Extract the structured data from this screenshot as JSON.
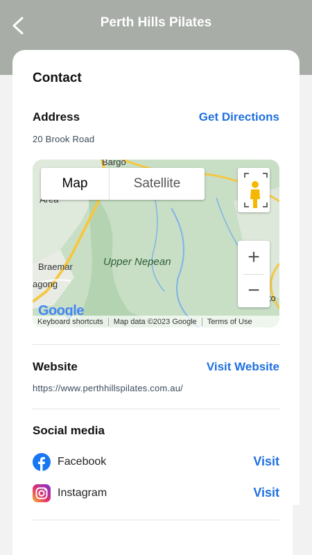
{
  "header": {
    "title": "Perth Hills Pilates",
    "back_icon": "chevron-left-icon"
  },
  "contact": {
    "heading": "Contact"
  },
  "address": {
    "label": "Address",
    "link": "Get Directions",
    "value": "20 Brook Road"
  },
  "map": {
    "tab_map": "Map",
    "tab_satellite": "Satellite",
    "zoom_in": "+",
    "zoom_out": "−",
    "place_labels": [
      "Bargo",
      "Upper Nepean",
      "Braemar",
      "agong",
      "Area",
      "Dapto"
    ],
    "attribution": [
      "Keyboard shortcuts",
      "Map data ©2023 Google",
      "Terms of Use"
    ],
    "logo": "Google"
  },
  "website": {
    "label": "Website",
    "link": "Visit Website",
    "url": "https://www.perthhillspilates.com.au/"
  },
  "social": {
    "label": "Social media",
    "items": [
      {
        "name": "Facebook",
        "action": "Visit",
        "icon": "facebook-icon",
        "color": "#1877F2"
      },
      {
        "name": "Instagram",
        "action": "Visit",
        "icon": "instagram-icon",
        "color": "#d6249f"
      }
    ]
  }
}
